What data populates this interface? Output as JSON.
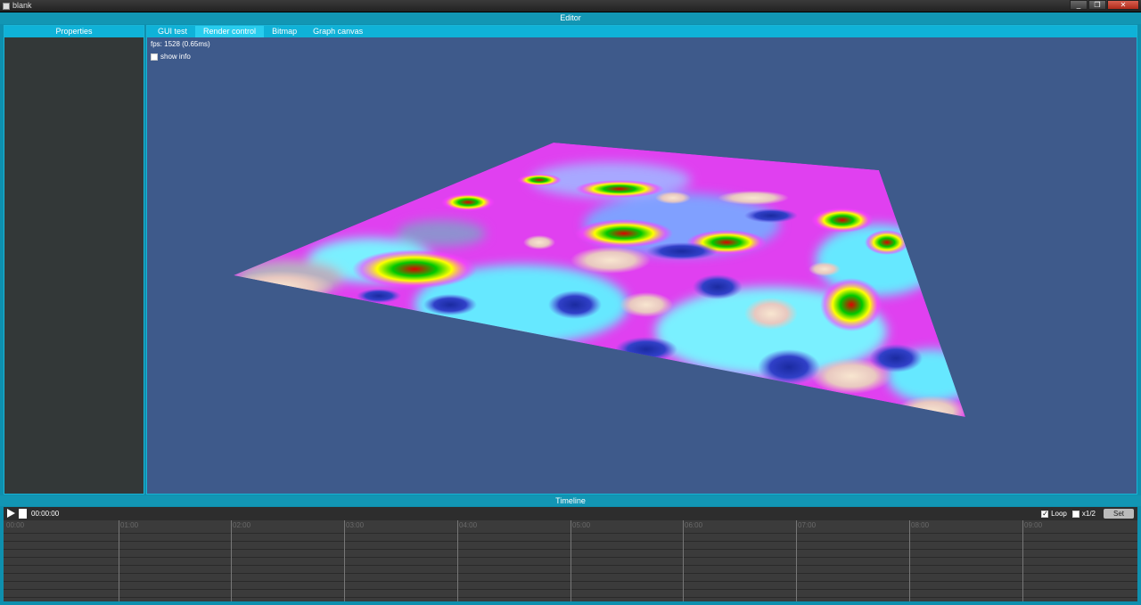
{
  "window": {
    "title": "blank",
    "buttons": [
      "_",
      "❐",
      "✕"
    ]
  },
  "editor": {
    "title": "Editor"
  },
  "properties": {
    "title": "Properties"
  },
  "tabs": [
    {
      "label": "GUI test",
      "active": false
    },
    {
      "label": "Render control",
      "active": true
    },
    {
      "label": "Bitmap",
      "active": false
    },
    {
      "label": "Graph canvas",
      "active": false
    }
  ],
  "render": {
    "fps_text": "fps: 1528 (0.65ms)",
    "show_info_label": "show info",
    "show_info_checked": false
  },
  "timeline": {
    "title": "Timeline",
    "time": "00:00:00",
    "loop_label": "Loop",
    "loop_checked": true,
    "half_label": "x1/2",
    "half_checked": false,
    "set_label": "Set",
    "markers": [
      "00:00",
      "01:00",
      "02:00",
      "03:00",
      "04:00",
      "05:00",
      "06:00",
      "07:00",
      "08:00",
      "09:00"
    ]
  },
  "colors": {
    "accent": "#0fb2d8",
    "frame": "#0e8fae",
    "viewport_bg": "#3e5a8b",
    "panel_bg": "#333838"
  }
}
